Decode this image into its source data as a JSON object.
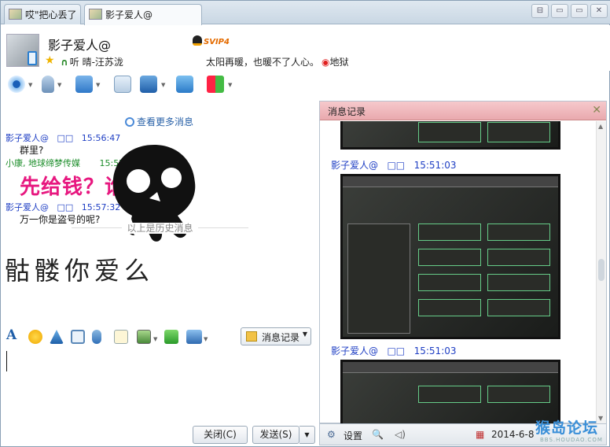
{
  "tabs": [
    {
      "label": "哎\"把心丢了"
    },
    {
      "label": "影子爱人@"
    }
  ],
  "window_buttons": [
    "⊟",
    "▭",
    "▭",
    "✕"
  ],
  "header": {
    "nickname": "影子爱人@",
    "badge": "SVIP4",
    "listening": "听 晴-汪苏泷",
    "signature": "太阳再暖，也暖不了人心。",
    "location": "地狱"
  },
  "chat": {
    "more": "查看更多消息",
    "messages": [
      {
        "sender": "影子爱人@",
        "ids": "□□",
        "time": "15:56:47",
        "text": "群里?"
      },
      {
        "sender": "小康, 地球缔梦传媒",
        "ids": "",
        "time": "15:57:01",
        "text": ""
      },
      {
        "sender": "影子爱人@",
        "ids": "□□",
        "time": "15:57:32",
        "text": "万一你是盗号的呢?"
      }
    ],
    "overlay_text": "先给钱？谁信啊",
    "history_divider": "以上是历史消息",
    "drawing_text": "骷髅你爱么"
  },
  "edit_toolbar": {
    "history_button": "消息记录"
  },
  "buttons": {
    "close": "关闭(C)",
    "send": "发送(S)"
  },
  "history_panel": {
    "title": "消息记录",
    "entries": [
      {
        "sender": "影子爱人@",
        "ids": "□□",
        "time": "15:51:03"
      },
      {
        "sender": "影子爱人@",
        "ids": "□□",
        "time": "15:51:03"
      }
    ],
    "footer": {
      "settings": "设置",
      "date": "2014-6-8"
    }
  },
  "watermark": {
    "title": "猴岛论坛",
    "url": "BBS.HOUDAO.COM"
  }
}
